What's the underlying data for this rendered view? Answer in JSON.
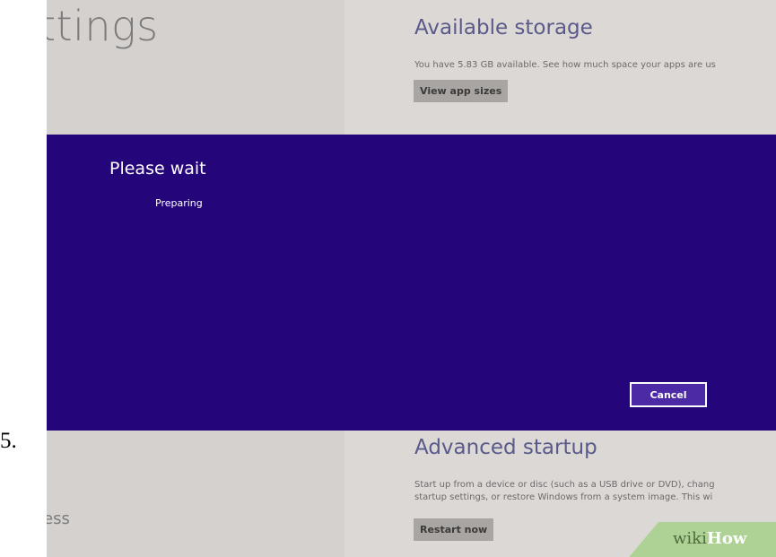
{
  "step_number": "5.",
  "settings": {
    "title_fragment": "ttings",
    "left_fragment": "ess",
    "left_fragment_2": "",
    "available_storage": {
      "title": "Available storage",
      "description": "You have 5.83 GB available. See how much space your apps are us",
      "button_label": "View app sizes"
    },
    "advanced_startup": {
      "title": "Advanced startup",
      "description_line1": "Start up from a device or disc (such as a USB drive or DVD), chang",
      "description_line2": "startup settings, or restore Windows from a system image. This wi",
      "button_label": "Restart now"
    }
  },
  "dialog": {
    "title": "Please wait",
    "status": "Preparing",
    "cancel_label": "Cancel",
    "background_color": "#25057a"
  },
  "watermark": {
    "part1": "wiki",
    "part2": "How"
  }
}
